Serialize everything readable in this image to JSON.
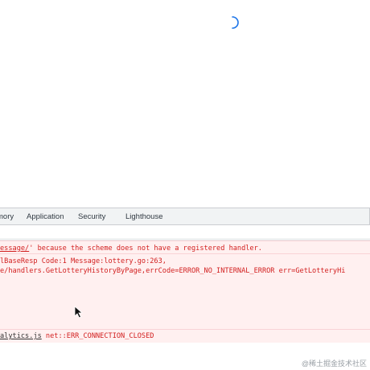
{
  "devtools": {
    "tabs": [
      {
        "label": "mory",
        "active": false
      },
      {
        "label": "Application",
        "active": false
      },
      {
        "label": "Security",
        "active": false
      },
      {
        "label": "Lighthouse",
        "active": false
      }
    ]
  },
  "console": {
    "messages": [
      {
        "level": "error",
        "lines": [
          {
            "link": "essage/",
            "text": "' because the scheme does not have a registered handler."
          }
        ]
      },
      {
        "level": "error",
        "lines": [
          {
            "text": "lBaseResp Code:1 Message:lottery.go:263,"
          },
          {
            "text": "e/handlers.GetLotteryHistoryByPage,errCode=ERROR_NO_INTERNAL_ERROR err=GetLotteryHi"
          }
        ]
      },
      {
        "level": "error",
        "lines": [
          {
            "link": "alytics.js",
            "text": " net::ERR_CONNECTION_CLOSED"
          }
        ]
      }
    ]
  },
  "watermark": "@稀土掘金技术社区",
  "colors": {
    "error_text": "#d21f1f",
    "error_bg": "#fff0f0",
    "error_border": "#f9d3d6",
    "tabbar_bg": "#f1f3f4",
    "spinner": "#1a73e8"
  },
  "icons": {
    "spinner": "loading-spinner-icon",
    "cursor": "mouse-pointer-icon"
  }
}
